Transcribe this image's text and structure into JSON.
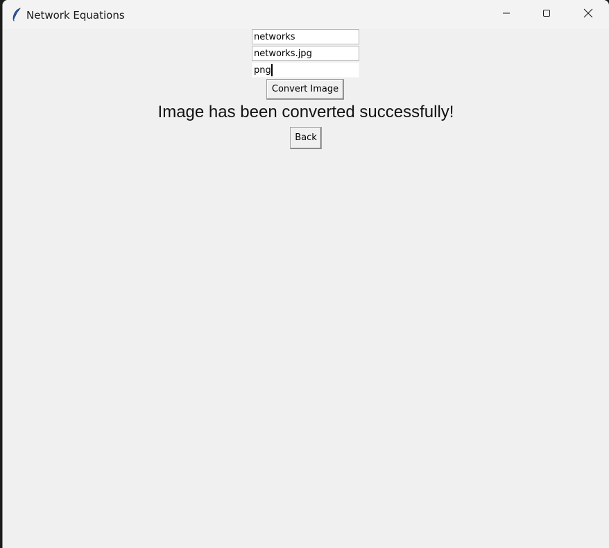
{
  "window": {
    "title": "Network Equations",
    "icon": "feather-icon",
    "controls": [
      "minimize-icon",
      "maximize-icon",
      "close-icon"
    ]
  },
  "form": {
    "field1_value": "networks",
    "field2_value": "networks.jpg",
    "field3_value": "png",
    "convert_label": "Convert Image",
    "status_message": "Image has been converted successfully!",
    "back_label": "Back"
  },
  "colors": {
    "window_bg": "#f0f0f0",
    "titlebar_bg": "#f3f3f3",
    "entry_bg": "#ffffff"
  }
}
